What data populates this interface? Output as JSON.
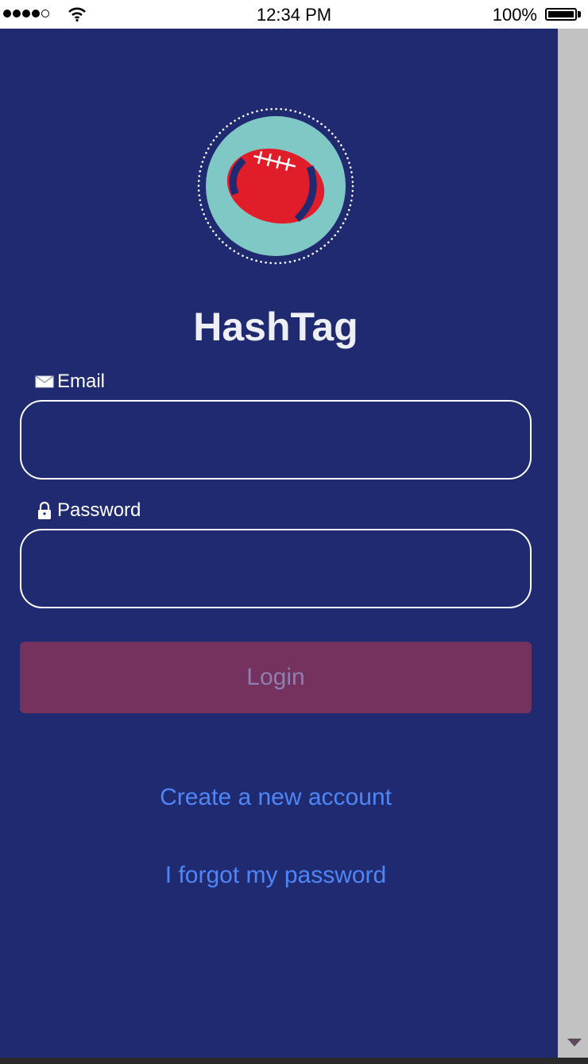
{
  "status_bar": {
    "time": "12:34 PM",
    "battery_percent": "100%",
    "signal_bars_filled": 4,
    "signal_bars_total": 5
  },
  "app": {
    "title": "HashTag",
    "logo_icon": "football-icon"
  },
  "form": {
    "email_label": "Email",
    "email_icon": "envelope-icon",
    "email_value": "",
    "password_label": "Password",
    "password_icon": "lock-icon",
    "password_value": "",
    "login_label": "Login"
  },
  "links": {
    "create_account": "Create a new account",
    "forgot_password": "I forgot my password"
  },
  "colors": {
    "background": "#1f2a70",
    "logo_circle": "#80c8c6",
    "football": "#e11d2a",
    "login_button": "#75325e",
    "login_text": "#8c7fb2",
    "link": "#4f86f7"
  }
}
